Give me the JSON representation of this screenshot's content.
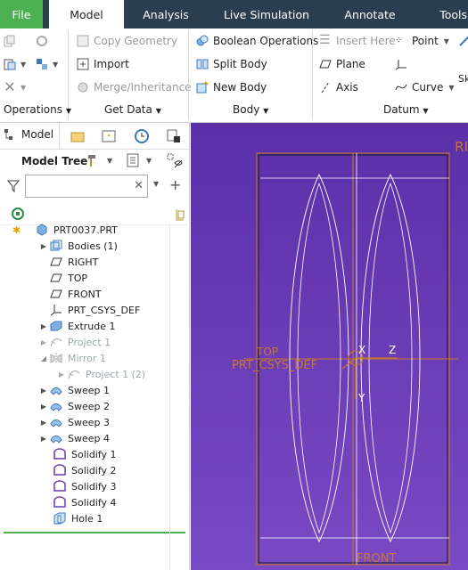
{
  "tabs": [
    {
      "label": "File"
    },
    {
      "label": "Model"
    },
    {
      "label": "Analysis"
    },
    {
      "label": "Live Simulation"
    },
    {
      "label": "Annotate"
    },
    {
      "label": "Tools"
    }
  ],
  "ribbon": {
    "copy_geometry": "Copy Geometry",
    "import": "Import",
    "merge_inheritance": "Merge/Inheritance",
    "boolean_operations": "Boolean Operations",
    "split_body": "Split Body",
    "new_body": "New Body",
    "insert_here": "Insert Here",
    "plane": "Plane",
    "axis": "Axis",
    "point": "Point",
    "curve": "Curve",
    "sk": "Sk",
    "groups": {
      "operations": "Operations",
      "get_data": "Get Data",
      "body": "Body",
      "datum": "Datum"
    }
  },
  "panel": {
    "tab_model": "Model",
    "model_tree_label": "Model Tree",
    "search_placeholder": "",
    "tree": [
      {
        "label": "PRT0037.PRT"
      },
      {
        "label": "Bodies (1)"
      },
      {
        "label": "RIGHT"
      },
      {
        "label": "TOP"
      },
      {
        "label": "FRONT"
      },
      {
        "label": "PRT_CSYS_DEF"
      },
      {
        "label": "Extrude 1"
      },
      {
        "label": "Project 1"
      },
      {
        "label": "Mirror 1"
      },
      {
        "label": "Project 1 (2)"
      },
      {
        "label": "Sweep 1"
      },
      {
        "label": "Sweep 2"
      },
      {
        "label": "Sweep 3"
      },
      {
        "label": "Sweep 4"
      },
      {
        "label": "Solidify 1"
      },
      {
        "label": "Solidify 2"
      },
      {
        "label": "Solidify 3"
      },
      {
        "label": "Solidify 4"
      },
      {
        "label": "Hole 1"
      }
    ]
  },
  "viewport": {
    "label_right": "RI",
    "label_top": "TOP",
    "label_csys": "PRT_CSYS_DEF",
    "label_x": "X",
    "label_z": "Z",
    "label_y": "Y",
    "label_front": "FRONT"
  },
  "colors": {
    "tabbar": "#2b3e50",
    "file_tab": "#4caf50",
    "viewport": "#6a3cb8",
    "datum": "#c8782a"
  }
}
